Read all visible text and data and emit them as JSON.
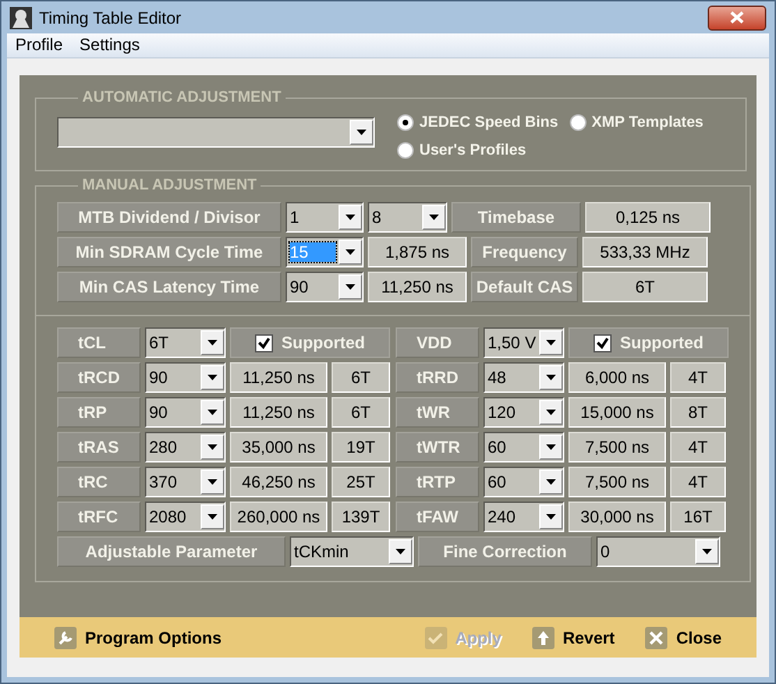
{
  "window": {
    "title": "Timing Table Editor"
  },
  "menu": [
    "Profile",
    "Settings"
  ],
  "automatic": {
    "title": "AUTOMATIC ADJUSTMENT",
    "radios": [
      {
        "label": "JEDEC Speed Bins",
        "selected": true
      },
      {
        "label": "XMP Templates",
        "selected": false
      },
      {
        "label": "User's Profiles",
        "selected": false
      }
    ]
  },
  "manual": {
    "title": "MANUAL ADJUSTMENT",
    "rows": [
      {
        "label": "MTB Dividend / Divisor",
        "combos": [
          {
            "value": "1",
            "focused": false
          },
          {
            "value": "8",
            "focused": false
          }
        ],
        "info_label": "Timebase",
        "info_value": "0,125 ns"
      },
      {
        "label": "Min SDRAM Cycle Time",
        "combos": [
          {
            "value": "15",
            "focused": true
          }
        ],
        "value": "1,875 ns",
        "info_label": "Frequency",
        "info_value": "533,33 MHz"
      },
      {
        "label": "Min CAS Latency Time",
        "combos": [
          {
            "value": "90",
            "focused": false
          }
        ],
        "value": "11,250 ns",
        "info_label": "Default CAS",
        "info_value": "6T"
      }
    ]
  },
  "timings": {
    "left": [
      {
        "kind": "check",
        "label": "tCL",
        "value": "6T",
        "check_label": "Supported",
        "checked": true
      },
      {
        "kind": "value",
        "label": "tRCD",
        "value": "90",
        "ns": "11,250 ns",
        "cycles": "6T"
      },
      {
        "kind": "value",
        "label": "tRP",
        "value": "90",
        "ns": "11,250 ns",
        "cycles": "6T"
      },
      {
        "kind": "value",
        "label": "tRAS",
        "value": "280",
        "ns": "35,000 ns",
        "cycles": "19T"
      },
      {
        "kind": "value",
        "label": "tRC",
        "value": "370",
        "ns": "46,250 ns",
        "cycles": "25T"
      },
      {
        "kind": "value",
        "label": "tRFC",
        "value": "2080",
        "ns": "260,000 ns",
        "cycles": "139T"
      }
    ],
    "right": [
      {
        "kind": "check",
        "label": "VDD",
        "value": "1,50 V",
        "check_label": "Supported",
        "checked": true
      },
      {
        "kind": "value",
        "label": "tRRD",
        "value": "48",
        "ns": "6,000 ns",
        "cycles": "4T"
      },
      {
        "kind": "value",
        "label": "tWR",
        "value": "120",
        "ns": "15,000 ns",
        "cycles": "8T"
      },
      {
        "kind": "value",
        "label": "tWTR",
        "value": "60",
        "ns": "7,500 ns",
        "cycles": "4T"
      },
      {
        "kind": "value",
        "label": "tRTP",
        "value": "60",
        "ns": "7,500 ns",
        "cycles": "4T"
      },
      {
        "kind": "value",
        "label": "tFAW",
        "value": "240",
        "ns": "30,000 ns",
        "cycles": "16T"
      }
    ]
  },
  "adjust": [
    {
      "label": "Adjustable Parameter",
      "value": "tCKmin"
    },
    {
      "label": "Fine Correction",
      "value": "0"
    }
  ],
  "footer": [
    {
      "kind": "options",
      "label": "Program Options",
      "disabled": false
    },
    {
      "kind": "apply",
      "label": "Apply",
      "disabled": true
    },
    {
      "kind": "revert",
      "label": "Revert",
      "disabled": false
    },
    {
      "kind": "close",
      "label": "Close",
      "disabled": false
    }
  ]
}
